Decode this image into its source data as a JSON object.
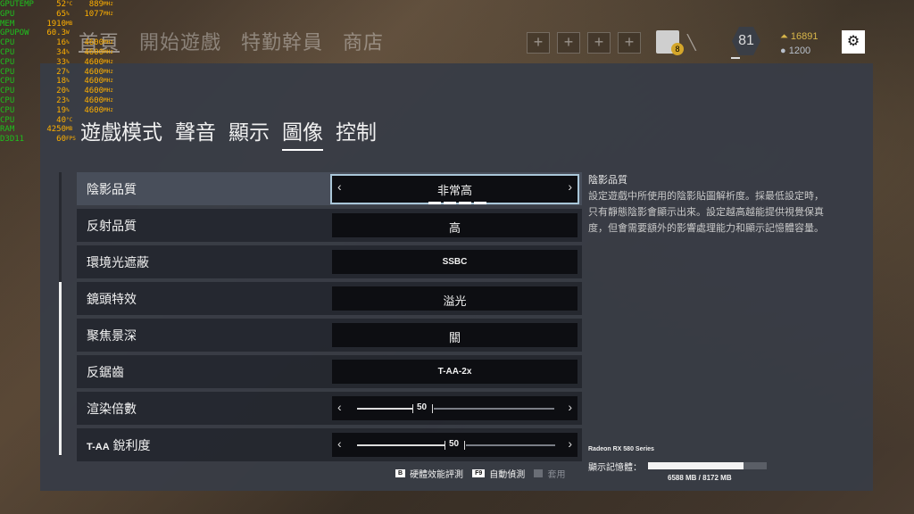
{
  "top_nav": {
    "items": [
      "首頁",
      "開始遊戲",
      "特勤幹員",
      "商店"
    ]
  },
  "top_slots": [
    "+",
    "+",
    "+",
    "+"
  ],
  "player": {
    "level": "81",
    "renown": "16891",
    "credits": "1200",
    "badge": "8"
  },
  "osd": [
    {
      "k": "GPUTEMP",
      "v1": "52",
      "u1": "°C",
      "v2": "889",
      "u2": "MHz"
    },
    {
      "k": "GPU",
      "v1": "65",
      "u1": "%",
      "v2": "1077",
      "u2": "MHz"
    },
    {
      "k": "MEM",
      "v1": "1910",
      "u1": "MB",
      "v2": "",
      "u2": ""
    },
    {
      "k": "GPUPOW",
      "v1": "60.3",
      "u1": "W",
      "v2": "",
      "u2": ""
    },
    {
      "k": "CPU",
      "v1": "16",
      "u1": "%",
      "v2": "4600",
      "u2": "MHz"
    },
    {
      "k": "CPU",
      "v1": "34",
      "u1": "%",
      "v2": "4600",
      "u2": "MHz"
    },
    {
      "k": "CPU",
      "v1": "33",
      "u1": "%",
      "v2": "4600",
      "u2": "MHz"
    },
    {
      "k": "CPU",
      "v1": "27",
      "u1": "%",
      "v2": "4600",
      "u2": "MHz"
    },
    {
      "k": "CPU",
      "v1": "18",
      "u1": "%",
      "v2": "4600",
      "u2": "MHz"
    },
    {
      "k": "CPU",
      "v1": "20",
      "u1": "%",
      "v2": "4600",
      "u2": "MHz"
    },
    {
      "k": "CPU",
      "v1": "23",
      "u1": "%",
      "v2": "4600",
      "u2": "MHz"
    },
    {
      "k": "CPU",
      "v1": "19",
      "u1": "%",
      "v2": "4600",
      "u2": "MHz"
    },
    {
      "k": "CPU",
      "v1": "40",
      "u1": "°C",
      "v2": "",
      "u2": ""
    },
    {
      "k": "RAM",
      "v1": "4250",
      "u1": "MB",
      "v2": "",
      "u2": ""
    },
    {
      "k": "D3D11",
      "v1": "60",
      "u1": "FPS",
      "v2": "",
      "u2": ""
    }
  ],
  "tabs": [
    "遊戲模式",
    "聲音",
    "顯示",
    "圖像",
    "控制"
  ],
  "active_tab": "圖像",
  "settings": [
    {
      "label": "陰影品質",
      "value": "非常高"
    },
    {
      "label": "反射品質",
      "value": "高"
    },
    {
      "label": "環境光遮蔽",
      "value": "SSBC"
    },
    {
      "label": "鏡頭特效",
      "value": "溢光"
    },
    {
      "label": "聚焦景深",
      "value": "關"
    },
    {
      "label": "反鋸齒",
      "value": "T-AA-2x"
    },
    {
      "label": "渲染倍數",
      "value": "50"
    },
    {
      "label_prefix": "T-AA",
      "label": " 銳利度",
      "value": "50"
    }
  ],
  "shadow_quality_level": 4,
  "shadow_quality_max": 4,
  "render_scale_fraction": 0.5,
  "taa_sharpness_fraction": 0.5,
  "description": {
    "title": "陰影品質",
    "body": "設定遊戲中所使用的陰影貼圖解析度。採最低設定時，只有靜態陰影會顯示出來。設定越高越能提供視覺保真度，但會需要額外的影響處理能力和顯示記憶體容量。"
  },
  "gpu": {
    "name": "Radeon RX 580 Series",
    "vram_label": "顯示記憶體：",
    "vram_used_mb": 6588,
    "vram_total_mb": 8172,
    "vram_text": "6588 MB / 8172 MB"
  },
  "footer": {
    "benchmark": {
      "key": "B",
      "label": "硬體效能評測"
    },
    "autodetect": {
      "key": "F9",
      "label": "自動偵測"
    },
    "apply": {
      "key": "■",
      "label": "套用"
    }
  }
}
